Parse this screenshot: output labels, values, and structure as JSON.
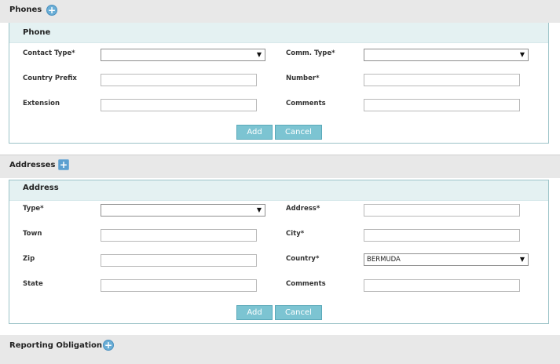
{
  "phones": {
    "section_label": "Phones",
    "add_icon": "plus-icon",
    "panel_title": "Phone",
    "fields": {
      "contact_type_label": "Contact Type*",
      "contact_type_value": "",
      "comm_type_label": "Comm. Type*",
      "comm_type_value": "",
      "country_prefix_label": "Country Prefix",
      "number_label": "Number*",
      "extension_label": "Extension",
      "comments_label": "Comments"
    },
    "add_label": "Add",
    "cancel_label": "Cancel"
  },
  "addresses": {
    "section_label": "Addresses",
    "add_icon": "plus-icon",
    "panel_title": "Address",
    "fields": {
      "type_label": "Type*",
      "type_value": "",
      "address_label": "Address*",
      "town_label": "Town",
      "city_label": "City*",
      "zip_label": "Zip",
      "country_label": "Country*",
      "country_value": "BERMUDA",
      "state_label": "State",
      "comments_label": "Comments"
    },
    "add_label": "Add",
    "cancel_label": "Cancel"
  },
  "reporting": {
    "section_label": "Reporting Obligation",
    "add_icon": "plus-icon"
  },
  "colors": {
    "button_bg": "#7cc4d2",
    "panel_header_bg": "#e4f1f2",
    "plus_icon": "#6aaed6"
  }
}
